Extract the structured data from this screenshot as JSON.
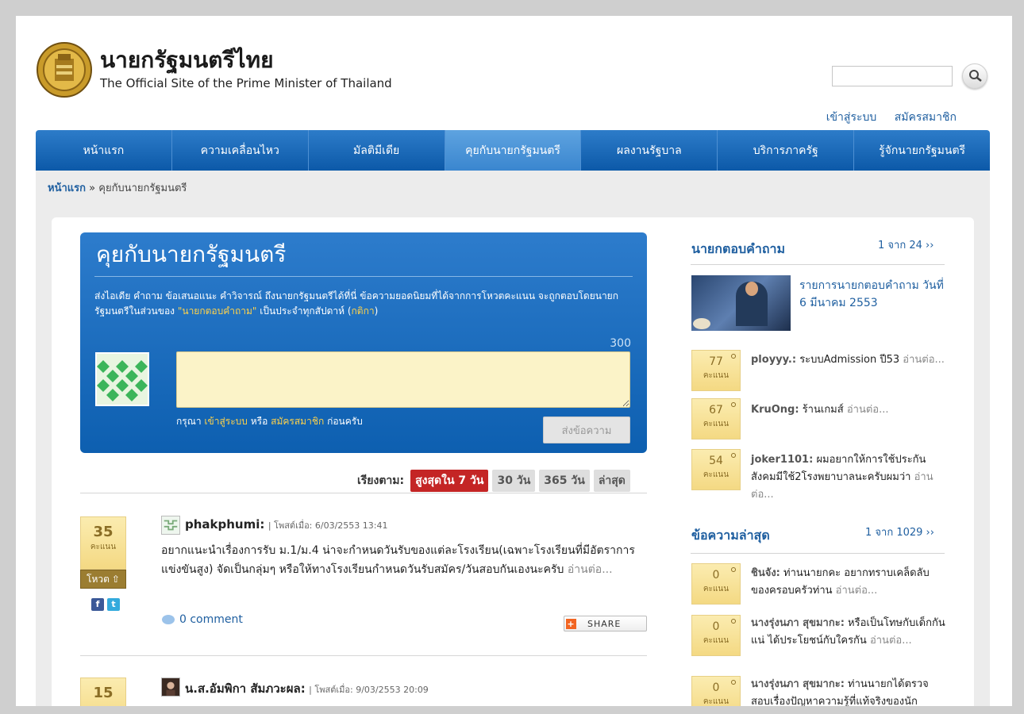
{
  "header": {
    "title": "นายกรัฐมนตรีไทย",
    "subtitle": "The Official Site of the Prime Minister of Thailand",
    "search_placeholder": "",
    "links": {
      "login": "เข้าสู่ระบบ",
      "register": "สมัครสมาชิก"
    }
  },
  "nav": {
    "items": [
      {
        "label": "หน้าแรก"
      },
      {
        "label": "ความเคลื่อนไหว"
      },
      {
        "label": "มัลติมีเดีย"
      },
      {
        "label": "คุยกับนายกรัฐมนตรี"
      },
      {
        "label": "ผลงานรัฐบาล"
      },
      {
        "label": "บริการภาครัฐ"
      },
      {
        "label": "รู้จักนายกรัฐมนตรี"
      }
    ]
  },
  "breadcrumb": {
    "home": "หน้าแรก",
    "sep": "»",
    "current": "คุยกับนายกรัฐมนตรี"
  },
  "compose": {
    "title": "คุยกับนายกรัฐมนตรี",
    "desc_1": "ส่งไอเดีย คำถาม ข้อเสนอแนะ คำวิจารณ์ ถึงนายกรัฐมนตรีได้ที่นี่ ข้อความยอดนิยมที่ได้จากการโหวตคะแนน จะถูกตอบโดยนายกรัฐมนตรีในส่วนของ",
    "desc_hl": "\"นายกตอบคำถาม\"",
    "desc_2": "เป็นประจำทุกสัปดาห์ (",
    "desc_rules": "กติกา",
    "desc_3": ")",
    "char_count": "300",
    "login_pre": "กรุณา",
    "login_link": "เข้าสู่ระบบ",
    "login_or": "หรือ",
    "login_register": "สมัครสมาชิก",
    "login_post": "ก่อนครับ",
    "send_label": "ส่งข้อความ"
  },
  "sort": {
    "label": "เรียงตาม:",
    "options": [
      {
        "label": "สูงสุดใน 7 วัน"
      },
      {
        "label": "30 วัน"
      },
      {
        "label": "365 วัน"
      },
      {
        "label": "ล่าสุด"
      }
    ]
  },
  "posts": [
    {
      "score": "35",
      "score_unit": "คะแนน",
      "vote_label": "โหวต",
      "author": "phakphumi:",
      "meta": "| โพสต์เมื่อ: 6/03/2553 13:41",
      "body": "อยากแนะนำเรื่องการรับ ม.1/ม.4 น่าจะกำหนดวันรับของแต่ละโรงเรียน(เฉพาะโรงเรียนที่มีอัตราการแข่งขันสูง) จัดเป็นกลุ่มๆ หรือให้ทางโรงเรียนกำหนดวันรับสมัคร/วันสอบกันเองนะครับ",
      "more": "อ่านต่อ...",
      "comments": "0 comment",
      "share": "SHARE"
    },
    {
      "score": "15",
      "author": "น.ส.อัมพิกา สัมภวะผล:",
      "meta": "| โพสต์เมื่อ: 9/03/2553 20:09"
    }
  ],
  "sidebar": {
    "answers": {
      "title": "นายกตอบคำถาม",
      "page": "1 จาก 24 ››",
      "featured": "รายการนายกตอบคำถาม วันที่ 6 มีนาคม 2553",
      "items": [
        {
          "score": "77",
          "unit": "คะแนน",
          "author": "ployyy.:",
          "text": "ระบบAdmission ปี53",
          "more": "อ่านต่อ..."
        },
        {
          "score": "67",
          "unit": "คะแนน",
          "author": "KruOng:",
          "text": "ร้านเกมส์",
          "more": "อ่านต่อ..."
        },
        {
          "score": "54",
          "unit": "คะแนน",
          "author": "joker1101:",
          "text": "ผมอยากให้การใช้ประกันสังคมมีใช้2โรงพยาบาลนะครับผมว่า",
          "more": "อ่านต่อ..."
        }
      ]
    },
    "latest": {
      "title": "ข้อความล่าสุด",
      "page": "1 จาก 1029 ››",
      "items": [
        {
          "score": "0",
          "unit": "คะแนน",
          "author": "ชินจัง:",
          "text": "ท่านนายกคะ อยากทราบเคล็ดลับของครอบครัวท่าน",
          "more": "อ่านต่อ..."
        },
        {
          "score": "0",
          "unit": "คะแนน",
          "author": "นางรุ่งนภา สุขมากะ:",
          "text": "หรือเป็นโทษกับเด็กกันแน่ ได้ประโยชน์กับใครกัน",
          "more": "อ่านต่อ..."
        },
        {
          "score": "0",
          "unit": "คะแนน",
          "author": "นางรุ่งนภา สุขมากะ:",
          "text": "ท่านนายกได้ตรวจสอบเรื่องปัญหาความรู้ที่แท้จริงของนัก"
        }
      ]
    }
  },
  "colors": {
    "nav_blue": "#0c59a8",
    "link_blue": "#1f5fa0",
    "score_gold": "#f4d983",
    "sort_active": "#c42525"
  }
}
